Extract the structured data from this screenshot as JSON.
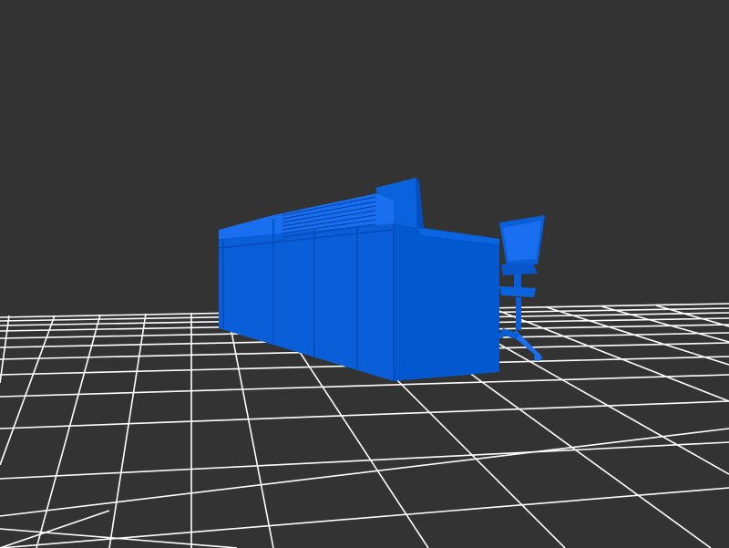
{
  "viewer": {
    "background_color": "#333333",
    "grid_color": "#ffffff",
    "model_color": "#0a5fd8",
    "model_color_light": "#1a6ff0",
    "model_color_dark": "#004fc0",
    "grid_visible": true
  },
  "model": {
    "icon": "desk-with-chair-model",
    "parts": [
      "reception-desk",
      "office-chair"
    ]
  }
}
